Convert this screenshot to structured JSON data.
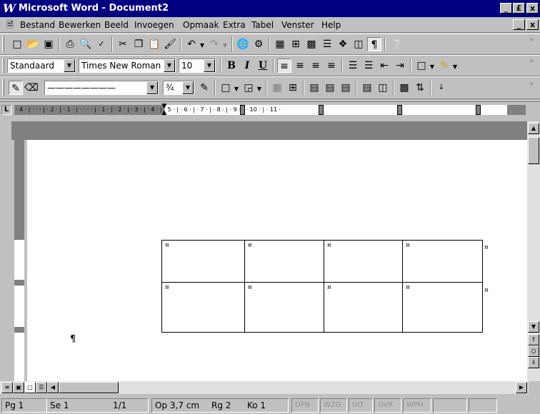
{
  "window": {
    "title": "Microsoft Word - Document2",
    "min": "_",
    "max": "£",
    "close": "x"
  },
  "menubar": {
    "items": [
      "Bestand",
      "Bewerken",
      "Beeld",
      "Invoegen",
      "Opmaak",
      "Extra",
      "Tabel",
      "Venster",
      "Help"
    ]
  },
  "format": {
    "style": "Standaard",
    "font": "Times New Roman",
    "size": "10",
    "bold": "B",
    "italic": "I",
    "underline": "U"
  },
  "drawing": {
    "line_style": "————————",
    "weight": "¾"
  },
  "ruler": {
    "h_text": "· 4 · | · · · | · 2 · | · 1 · | · · · · | · 1 · | · 2 · | · 3 · | · 4 · | · 5 · | · 6 · | · 7 · | · 8 · | · 9 · | · 10 · | · 11 ·",
    "tab": "L"
  },
  "document": {
    "cell_mark": "¤",
    "paragraph_mark": "¶"
  },
  "statusbar": {
    "page": "Pg 1",
    "section": "Se 1",
    "pages": "1/1",
    "at": "Op 3,7 cm",
    "line": "Rg 2",
    "col": "Ko 1",
    "modes": [
      "OPN",
      "WZG",
      "UIT",
      "OVR",
      "WPH"
    ]
  }
}
